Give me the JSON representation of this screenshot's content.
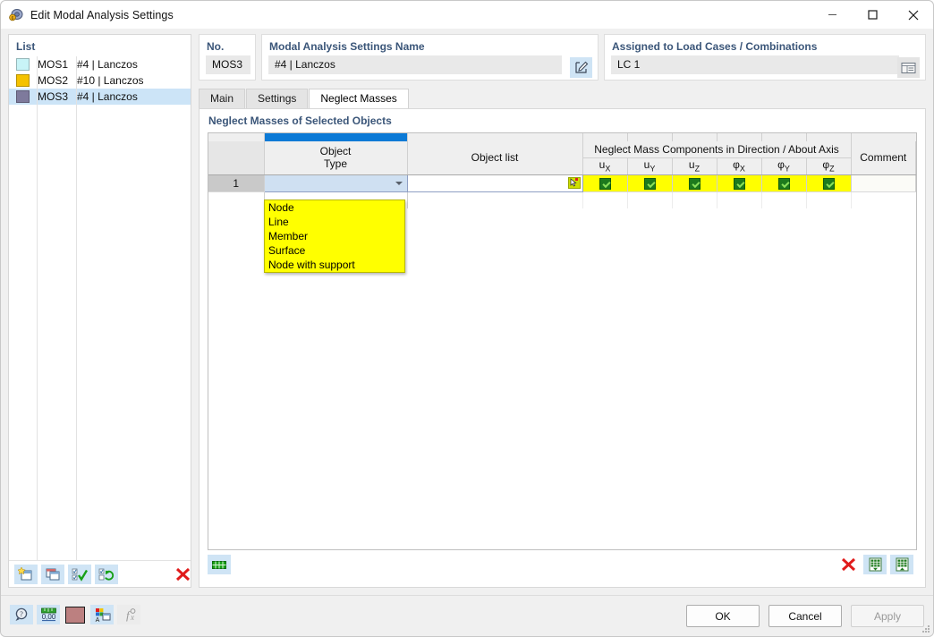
{
  "window": {
    "title": "Edit Modal Analysis Settings",
    "app_icon": "modal-analysis-icon",
    "minimize": "–",
    "maximize": "□",
    "close": "✕"
  },
  "left_panel": {
    "title": "List",
    "items": [
      {
        "code": "MOS1",
        "name": "#4 | Lanczos",
        "color": "#c8f4f7",
        "selected": false
      },
      {
        "code": "MOS2",
        "name": "#10 | Lanczos",
        "color": "#f5c200",
        "selected": false
      },
      {
        "code": "MOS3",
        "name": "#4 | Lanczos",
        "color": "#7e7a9c",
        "selected": true
      }
    ],
    "toolbar": [
      {
        "icon": "new-item-icon",
        "name": "new-modal-settings-button"
      },
      {
        "icon": "copy-item-icon",
        "name": "copy-modal-settings-button"
      },
      {
        "icon": "select-all-icon",
        "name": "select-all-button"
      },
      {
        "icon": "refresh-selection-icon",
        "name": "refresh-selection-button"
      },
      {
        "icon": "delete-red-x-icon",
        "name": "delete-button"
      }
    ]
  },
  "header": {
    "no_label": "No.",
    "no_value": "MOS3",
    "name_label": "Modal Analysis Settings Name",
    "name_value": "#4 | Lanczos",
    "name_edit_icon": "pencil-edit-icon",
    "assigned_label": "Assigned to Load Cases / Combinations",
    "assigned_value": "LC 1",
    "assigned_picker_icon": "table-list-icon"
  },
  "tabs": [
    {
      "label": "Main",
      "active": false
    },
    {
      "label": "Settings",
      "active": false
    },
    {
      "label": "Neglect Masses",
      "active": true
    }
  ],
  "content": {
    "section_title": "Neglect Masses of Selected Objects",
    "grid": {
      "group_header": "Neglect Mass Components in Direction / About Axis",
      "columns": [
        {
          "key": "rowno",
          "label": ""
        },
        {
          "key": "object_type",
          "label_line1": "Object",
          "label_line2": "Type"
        },
        {
          "key": "object_list",
          "label": "Object list"
        },
        {
          "key": "ux",
          "base": "u",
          "sub": "X"
        },
        {
          "key": "uy",
          "base": "u",
          "sub": "Y"
        },
        {
          "key": "uz",
          "base": "u",
          "sub": "Z"
        },
        {
          "key": "phix",
          "base": "φ",
          "sub": "X"
        },
        {
          "key": "phiy",
          "base": "φ",
          "sub": "Y"
        },
        {
          "key": "phiz",
          "base": "φ",
          "sub": "Z"
        },
        {
          "key": "comment",
          "label": "Comment"
        }
      ],
      "rows": [
        {
          "no": "1",
          "object_type": "",
          "object_list": "",
          "ux": true,
          "uy": true,
          "uz": true,
          "phix": true,
          "phiy": true,
          "phiz": true,
          "comment": ""
        }
      ]
    },
    "dropdown": {
      "open": true,
      "options": [
        "Node",
        "Line",
        "Member",
        "Surface",
        "Node with support"
      ]
    },
    "grid_toolbar": {
      "left": [
        {
          "icon": "green-bar-icon",
          "name": "grid-settings-button"
        }
      ],
      "right": [
        {
          "icon": "delete-red-x-icon",
          "name": "grid-delete-button"
        },
        {
          "icon": "export-table-icon",
          "name": "import-table-button"
        },
        {
          "icon": "export-table-icon-2",
          "name": "export-table-button"
        }
      ]
    }
  },
  "footer": {
    "left_icons": [
      {
        "icon": "help-magnifier-icon",
        "name": "help-button"
      },
      {
        "icon": "units-ruler-icon",
        "name": "units-button"
      },
      {
        "icon": "color-swatch-icon",
        "name": "color-button",
        "color": "#bc8080"
      },
      {
        "icon": "display-properties-icon",
        "name": "display-properties-button"
      },
      {
        "icon": "formula-fx-icon",
        "name": "formula-button",
        "disabled": true
      }
    ],
    "buttons": [
      {
        "label": "OK",
        "name": "ok-button",
        "disabled": false
      },
      {
        "label": "Cancel",
        "name": "cancel-button",
        "disabled": false
      },
      {
        "label": "Apply",
        "name": "apply-button",
        "disabled": true
      }
    ]
  },
  "colors": {
    "accent_blue": "#0c7ad6",
    "label_blue": "#3b5679",
    "highlight_yellow": "#ffff00",
    "check_green": "#1d7a1d",
    "delete_red": "#e01b1b"
  }
}
